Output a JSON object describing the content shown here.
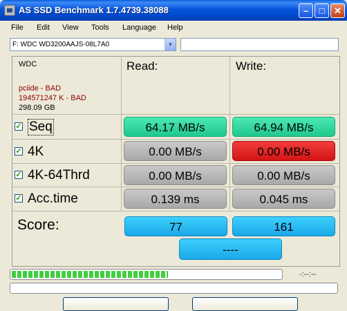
{
  "window": {
    "title": "AS SSD Benchmark 1.7.4739.38088",
    "minimize_glyph": "–",
    "maximize_glyph": "□",
    "close_glyph": "✕"
  },
  "menu": [
    "File",
    "Edit",
    "View",
    "Tools",
    "Language",
    "Help"
  ],
  "drive": {
    "selected": "F: WDC WD3200AAJS-08L7A0",
    "path_value": ""
  },
  "drive_info": {
    "model": "WDC",
    "driver": "pciide - BAD",
    "alignment": "194571247 K - BAD",
    "size": "298.09 GB"
  },
  "headers": {
    "read": "Read:",
    "write": "Write:"
  },
  "rows": [
    {
      "label": "Seq",
      "checked": true,
      "read": "64.17 MB/s",
      "write": "64.94 MB/s",
      "read_status": "green",
      "write_status": "green"
    },
    {
      "label": "4K",
      "checked": true,
      "read": "0.00 MB/s",
      "write": "0.00 MB/s",
      "read_status": "gray",
      "write_status": "red"
    },
    {
      "label": "4K-64Thrd",
      "checked": true,
      "read": "0.00 MB/s",
      "write": "0.00 MB/s",
      "read_status": "gray",
      "write_status": "gray"
    },
    {
      "label": "Acc.time",
      "checked": true,
      "read": "0.139 ms",
      "write": "0.045 ms",
      "read_status": "gray",
      "write_status": "gray"
    }
  ],
  "score": {
    "label": "Score:",
    "read": "77",
    "write": "161",
    "total": "----"
  },
  "progress": {
    "fraction": 0.58,
    "elapsed": "-:--:--"
  },
  "colors": {
    "green": "#20c88d",
    "red": "#d31414",
    "gray": "#a8a8a8",
    "blue": "#1aa8e8",
    "bad_text": "#8b0000"
  },
  "icons": [
    "app-icon",
    "dropdown-arrow-icon",
    "checkbox-checked-icon"
  ]
}
